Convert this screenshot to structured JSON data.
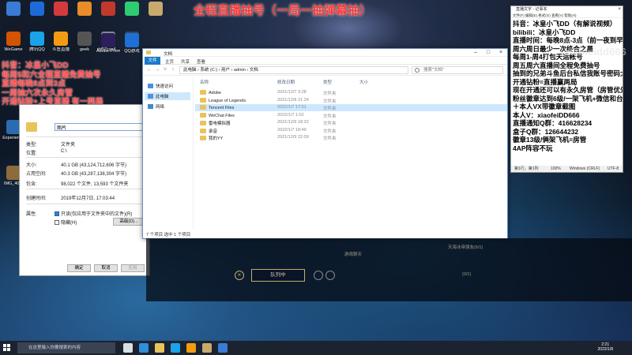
{
  "overlay": {
    "title": "全程直播抽号（一局一抽弹幕抽）",
    "notes": [
      "抖音：冰皇小飞DD",
      "每周5和六全程直播免费抽号",
      "直播每晚8点到3点",
      "一周抽六次永久房管",
      "开通钻粉+上号直播 有一两局"
    ]
  },
  "desktop_icons": [
    {
      "label": "",
      "color": "#3a7bd5"
    },
    {
      "label": "",
      "color": "#1e6ad8"
    },
    {
      "label": "",
      "color": "#d23b3b"
    },
    {
      "label": "",
      "color": "#e98c2a"
    },
    {
      "label": "",
      "color": "#c0392b"
    },
    {
      "label": "",
      "color": "#2ecc71"
    },
    {
      "label": "",
      "color": "#c8aa6e"
    },
    {
      "label": "腾讯QQ",
      "color": "#1aa3e8"
    },
    {
      "label": "斗鱼直播",
      "color": "#f39c12"
    },
    {
      "label": "geek",
      "color": "#555"
    },
    {
      "label": "dd97cyo4...",
      "color": "#7f8c8d"
    },
    {
      "label": "WeGame",
      "color": "#d35400"
    },
    {
      "label": "",
      "color": "#34495e"
    },
    {
      "label": "Adobe Premiere",
      "color": "#2c1f5c"
    },
    {
      "label": "QQ游戏",
      "color": "#1f6fd6"
    },
    {
      "label": "Experience",
      "color": "#2b6cb0"
    },
    {
      "label": "IMG_40...",
      "color": "#8e6b3a"
    }
  ],
  "properties_dialog": {
    "folder_name": "图片",
    "type_label": "类型:",
    "type_value": "文件夹",
    "location_label": "位置:",
    "location_value": "C:\\",
    "size_label": "大小:",
    "size_value": "40.1 GB (43,124,712,606 字节)",
    "disk_size_label": "占用空间:",
    "disk_size_value": "40.3 GB (43,287,138,304 字节)",
    "contains_label": "包含:",
    "contains_value": "98,022 个文件, 13,593 个文件夹",
    "created_label": "创建时间:",
    "created_value": "2019年12月7日, 17:03:44",
    "attr_label": "属性:",
    "readonly_label": "只读(仅应用于文件夹中的文件)(R)",
    "hidden_label": "隐藏(H)",
    "advanced_button": "高级(D)...",
    "ok_button": "确定",
    "cancel_button": "取消",
    "apply_button": "应用"
  },
  "explorer": {
    "title": "文档",
    "tabs": [
      "文件",
      "主页",
      "共享",
      "查看"
    ],
    "address": "此电脑 › 系统 (C:) › 用户 › admin › 文档",
    "search_placeholder": "搜索\"文档\"",
    "nav_items": [
      "快速访问",
      "此电脑",
      "网络"
    ],
    "headers": {
      "name": "名称",
      "date": "修改日期",
      "type": "类型",
      "size": "大小"
    },
    "files": [
      {
        "name": "Adobe",
        "date": "2021/12/7 3:28",
        "type": "文件夹"
      },
      {
        "name": "League of Legends",
        "date": "2021/12/8 21:24",
        "type": "文件夹"
      },
      {
        "name": "Tencent Files",
        "date": "2022/1/7 17:51",
        "type": "文件夹"
      },
      {
        "name": "WeChat Files",
        "date": "2022/1/7 1:02",
        "type": "文件夹"
      },
      {
        "name": "雷电模拟器",
        "date": "2021/12/9 18:32",
        "type": "文件夹"
      },
      {
        "name": "录音",
        "date": "2022/1/7 18:49",
        "type": "文件夹"
      },
      {
        "name": "我的YY",
        "date": "2021/12/9 22:09",
        "type": "文件夹"
      }
    ],
    "selected_index": 2,
    "status": "7 个项目  选中 1 个项目"
  },
  "notepad": {
    "title": "直播文字 - 记事本",
    "menu": "文件(F) 编辑(E) 格式(O) 查看(V) 帮助(H)",
    "lines": [
      "抖音：冰皇小飞DD（有解说视频）",
      "bilibili：冰皇小飞DD",
      "直播时间：每晚8点-3点（前一夜到早）",
      "周六周日最少一次终合之晨",
      "每周1-周4打包天运帐号",
      "周五周六直播间全程免费抽号",
      "抽到的兄弟斗鱼后台私信我账号密码大区",
      "开通钻粉=直播赢两局",
      "现在开通还可以有永久房管（房管优先上车）",
      "粉丝徽章达到6级/一架飞机+微信和台群",
      "＋本人VX带徽章截图",
      "本人V：xiaofeiDD666",
      "直播通知Q群：416628234",
      "盒子Q群：126644232",
      "徽章13级/俩架飞机=房管",
      "4AP阵容不玩"
    ],
    "status_pos": "第1行，第1列",
    "status_zoom": "100%",
    "status_eol": "Windows (CRLF)",
    "status_enc": "UTF-8"
  },
  "watermark": "xiaofeidd666",
  "lobby": {
    "queue_button": "队列中",
    "room_label": "游戏聊天",
    "friends_header": "天海冰帝朋友(6/1)",
    "friend_status": "(0/1)"
  },
  "taskbar": {
    "search_placeholder": "在这里输入你要搜索的内容",
    "time": "2:21",
    "date": "2022/1/8"
  }
}
